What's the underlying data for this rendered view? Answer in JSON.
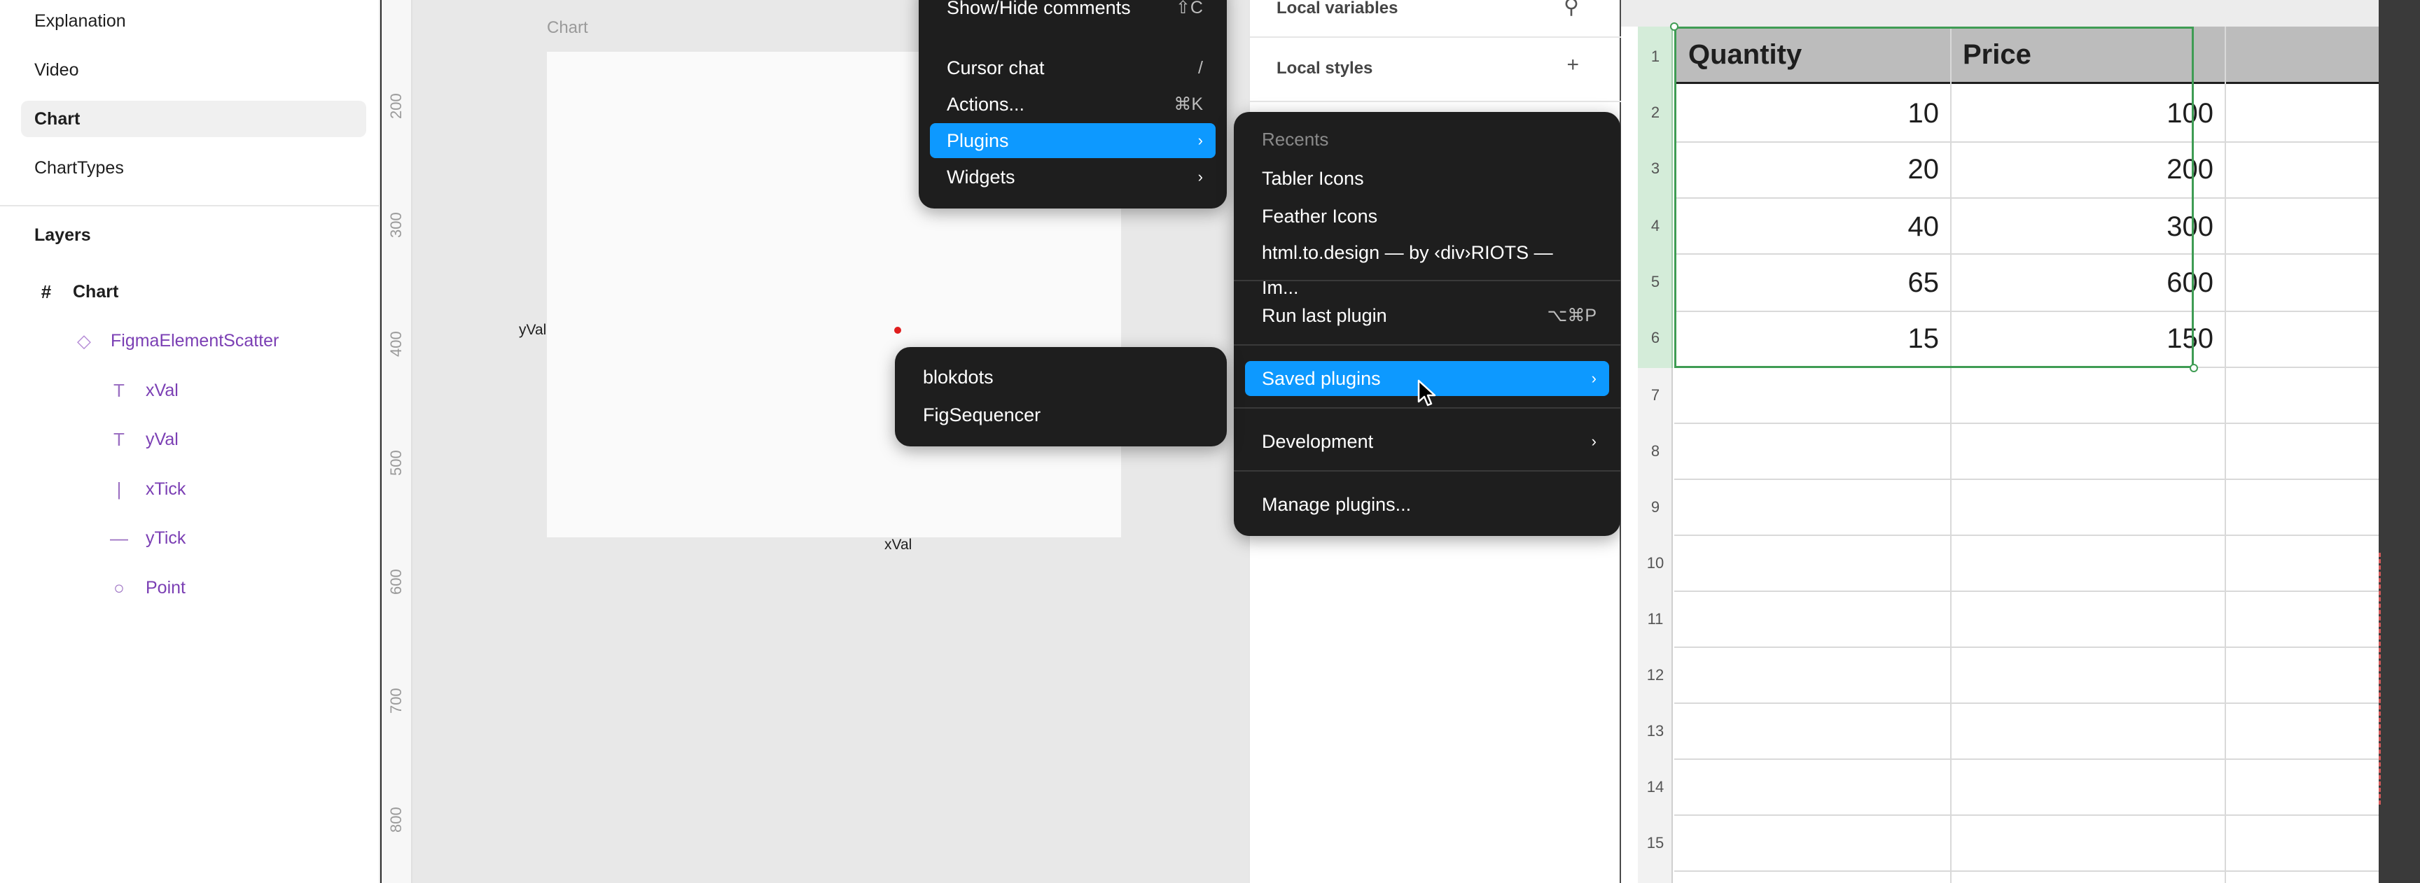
{
  "pages": {
    "items": [
      {
        "label": "Explanation",
        "active": false
      },
      {
        "label": "Video",
        "active": false
      },
      {
        "label": "Chart",
        "active": true
      },
      {
        "label": "ChartTypes",
        "active": false
      }
    ]
  },
  "layers": {
    "title": "Layers",
    "items": [
      {
        "label": "Chart",
        "icon": "frame-icon",
        "glyph": "#"
      },
      {
        "label": "FigmaElementScatter",
        "icon": "component-icon",
        "glyph": "◇"
      },
      {
        "label": "xVal",
        "icon": "text-icon",
        "glyph": "T"
      },
      {
        "label": "yVal",
        "icon": "text-icon",
        "glyph": "T"
      },
      {
        "label": "xTick",
        "icon": "vertical-line-icon",
        "glyph": "|"
      },
      {
        "label": "yTick",
        "icon": "horizontal-line-icon",
        "glyph": "—"
      },
      {
        "label": "Point",
        "icon": "ellipse-icon",
        "glyph": "○"
      }
    ]
  },
  "canvas": {
    "ruler": [
      "200",
      "300",
      "400",
      "500",
      "600",
      "700",
      "800"
    ],
    "frame_label": "Chart",
    "y_label": "yVal",
    "x_label": "xVal"
  },
  "right_panel": {
    "local_variables": "Local variables",
    "local_styles": "Local styles",
    "add_glyph": "+",
    "variables_glyph": "⚲"
  },
  "main_menu": {
    "items": [
      {
        "label": "Show/Hide comments",
        "shortcut": "⇧C"
      },
      {
        "label": "Cursor chat",
        "shortcut": "/"
      },
      {
        "label": "Actions...",
        "shortcut": "⌘K"
      },
      {
        "label": "Plugins",
        "chevron": "›"
      },
      {
        "label": "Widgets",
        "chevron": "›"
      }
    ]
  },
  "plugins_menu": {
    "heading": "Recents",
    "recents": [
      "Tabler Icons",
      "Feather Icons",
      "html.to.design — by ‹div›RIOTS — Im..."
    ],
    "run_last": {
      "label": "Run last plugin",
      "shortcut": "⌥⌘P"
    },
    "saved": {
      "label": "Saved plugins",
      "chevron": "›"
    },
    "development": {
      "label": "Development",
      "chevron": "›"
    },
    "manage": {
      "label": "Manage plugins..."
    }
  },
  "saved_menu": {
    "items": [
      "blokdots",
      "FigSequencer"
    ]
  },
  "sheet": {
    "headers": [
      "Quantity",
      "Price"
    ],
    "rows": [
      [
        "10",
        "100"
      ],
      [
        "20",
        "200"
      ],
      [
        "40",
        "300"
      ],
      [
        "65",
        "600"
      ],
      [
        "15",
        "150"
      ]
    ],
    "row_numbers": [
      "1",
      "2",
      "3",
      "4",
      "5",
      "6",
      "7",
      "8",
      "9",
      "10",
      "11",
      "12",
      "13",
      "14",
      "15"
    ]
  },
  "colors": {
    "accent": "#0d99ff",
    "point": "#e01e1e",
    "selection": "#3f9c54"
  }
}
